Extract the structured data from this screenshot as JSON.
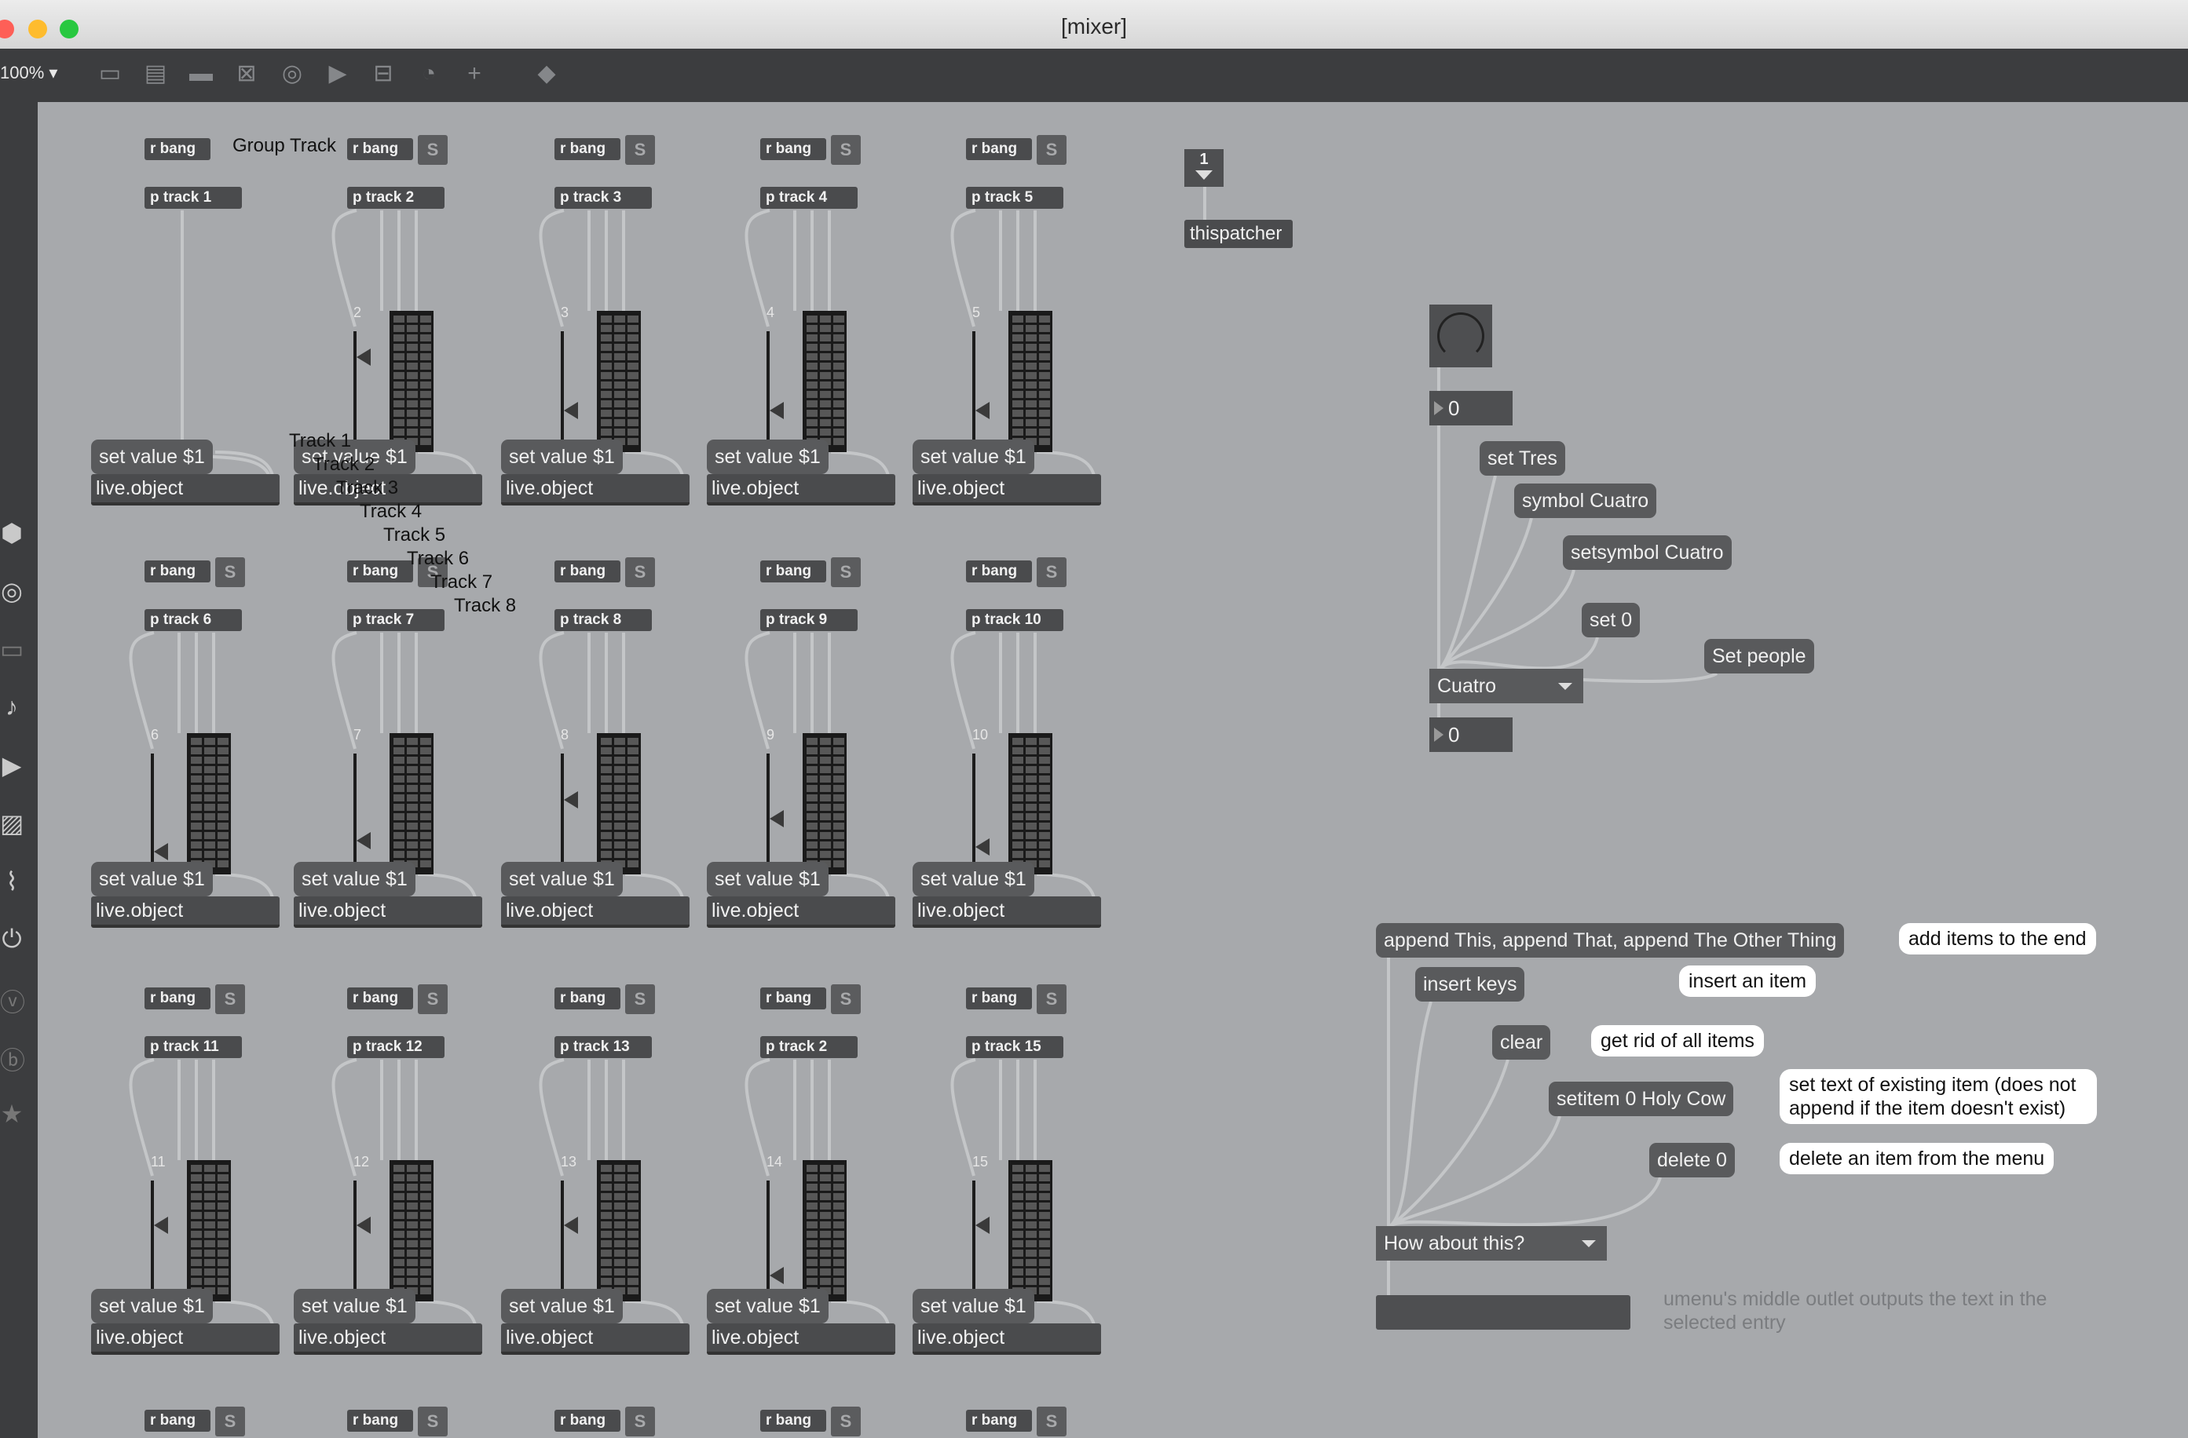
{
  "window": {
    "title": "[mixer]",
    "traffic_lights": {
      "close": "#fe5f57",
      "minimize": "#febc2e",
      "zoom": "#28c840"
    }
  },
  "toolbar": {
    "zoom": "100%",
    "zoom_arrow": "▾",
    "icons": [
      "presentation-icon",
      "device-icon",
      "comment-icon",
      "clear-icon",
      "record-icon",
      "play-icon",
      "bar-icon",
      "dial-icon",
      "add-icon",
      "paint-icon"
    ]
  },
  "sidebar": {
    "icons": [
      "package-icon",
      "target-icon",
      "film-icon",
      "music-icon",
      "video-icon",
      "image-icon",
      "clip-icon",
      "plug-icon",
      "vimeo-icon",
      "b-icon",
      "star-icon"
    ]
  },
  "colors": {
    "canvas": "#a7a9ac",
    "object": "#4a4b4d",
    "message": "#595a5c",
    "comment_bubble": "#ffffff",
    "toolbar": "#3c3d3f"
  },
  "patch": {
    "group_track_label": "Group Track",
    "rbang": "r bang",
    "s_label": "S",
    "set_value": "set value $1",
    "live_object": "live.object",
    "tracks": [
      {
        "p": "p track 1",
        "num": ""
      },
      {
        "p": "p track 2",
        "num": "2"
      },
      {
        "p": "p track 3",
        "num": "3"
      },
      {
        "p": "p track 4",
        "num": "4"
      },
      {
        "p": "p track 5",
        "num": "5"
      },
      {
        "p": "p track 6",
        "num": "6"
      },
      {
        "p": "p track 7",
        "num": "7"
      },
      {
        "p": "p track 8",
        "num": "8"
      },
      {
        "p": "p track 9",
        "num": "9"
      },
      {
        "p": "p track 10",
        "num": "10"
      },
      {
        "p": "p track 11",
        "num": "11"
      },
      {
        "p": "p track 12",
        "num": "12"
      },
      {
        "p": "p track 13",
        "num": "13"
      },
      {
        "p": "p track 2",
        "num": "14"
      },
      {
        "p": "p track 15",
        "num": "15"
      }
    ],
    "track_list_labels": [
      "Track 1",
      "Track 2",
      "Track 3",
      "Track 4",
      "Track 5",
      "Track 6",
      "Track 7",
      "Track 8"
    ],
    "loadbang_value": "1",
    "thispatcher": "thispatcher",
    "right_top": {
      "number_top": "0",
      "msg_set_tres": "set Tres",
      "msg_symbol": "symbol Cuatro",
      "msg_setsymbol": "setsymbol Cuatro",
      "msg_set0": "set 0",
      "msg_set_people": "Set people",
      "umenu_value": "Cuatro",
      "number_bottom": "0"
    },
    "right_bottom": {
      "msg_append": "append This, append That, append The Other Thing",
      "comment_append": "add items to the end",
      "msg_insert": "insert keys",
      "comment_insert": "insert an item",
      "msg_clear": "clear",
      "comment_clear": "get rid of all items",
      "msg_setitem": "setitem 0 Holy Cow",
      "comment_setitem": "set text of existing item (does not append if the item doesn't exist)",
      "msg_delete": "delete 0",
      "comment_delete": "delete an item from the menu",
      "umenu_value": "How about this?",
      "comment_outlet": "umenu's middle outlet outputs the text in the selected entry"
    }
  }
}
